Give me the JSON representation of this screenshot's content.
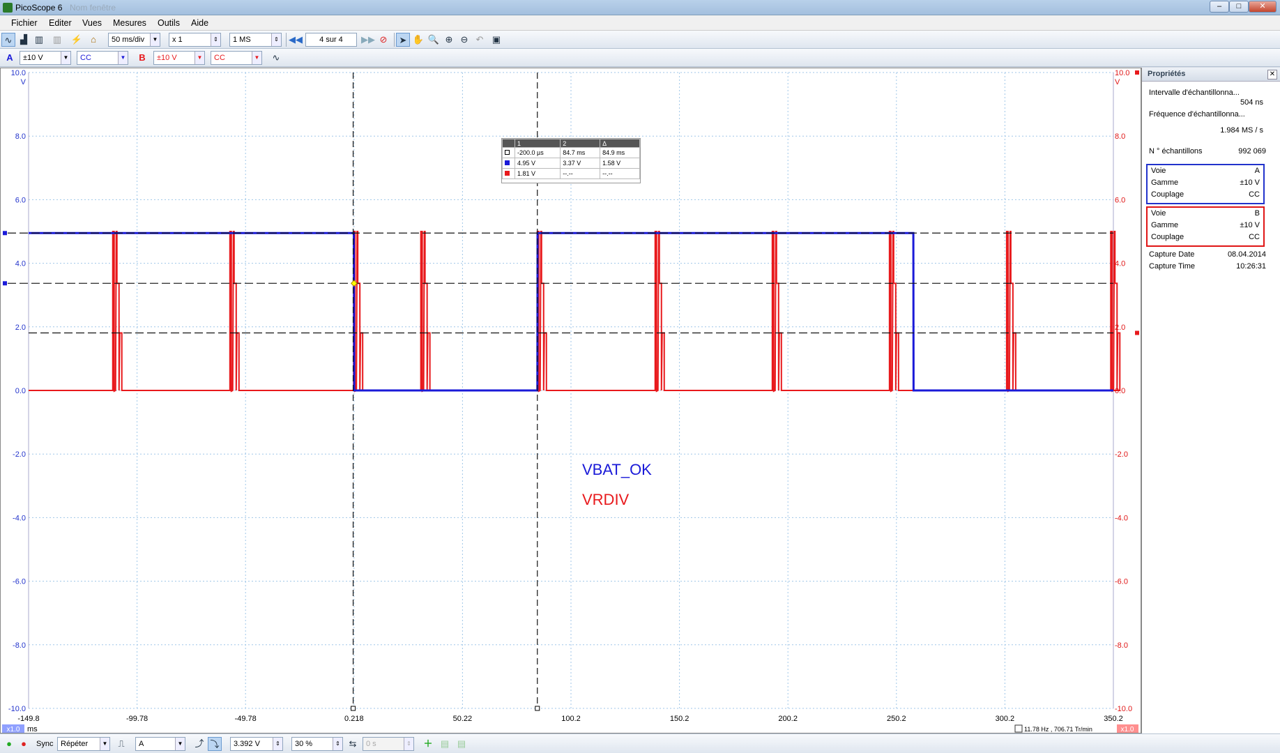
{
  "window": {
    "title": "PicoScope 6",
    "ghost_title": "Nom fenêtre",
    "btn_min": "–",
    "btn_max": "□",
    "btn_close": "✕"
  },
  "menu": [
    "Fichier",
    "Editer",
    "Vues",
    "Mesures",
    "Outils",
    "Aide"
  ],
  "toolbar1": {
    "timebase": "50 ms/div",
    "zoom": "x 1",
    "samples": "1 MS",
    "buffer": "4 sur 4"
  },
  "toolbar2": {
    "chA": {
      "label": "A",
      "range": "±10 V",
      "coupling": "CC"
    },
    "chB": {
      "label": "B",
      "range": "±10 V",
      "coupling": "CC"
    }
  },
  "scope": {
    "y_ticks_left": [
      "10.0",
      "8.0",
      "6.0",
      "4.0",
      "2.0",
      "0.0",
      "-2.0",
      "-4.0",
      "-6.0",
      "-8.0",
      "-10.0"
    ],
    "y_ticks_right": [
      "10.0",
      "8.0",
      "6.0",
      "4.0",
      "2.0",
      "0.0",
      "-2.0",
      "-4.0",
      "-6.0",
      "-8.0",
      "-10.0"
    ],
    "y_unit": "V",
    "x_ticks": [
      "-149.8",
      "-99.78",
      "-49.78",
      "0.218",
      "50.22",
      "100.2",
      "150.2",
      "200.2",
      "250.2",
      "300.2",
      "350.2"
    ],
    "x_unit": "ms",
    "x_zoom": "x1.0",
    "right_zoom": "x1.0",
    "annot_blue": "VBAT_OK",
    "annot_red": "VRDIV",
    "rate_readout": "11.78 Hz , 706.71 Tr/min",
    "colors": {
      "chA": "#1a1ad8",
      "chB": "#e8191c",
      "grid": "#9fc6e8",
      "axis_left": "#2233cc",
      "axis_right": "#e01515"
    }
  },
  "rulers": {
    "headers": [
      "1",
      "2",
      "Δ"
    ],
    "rows": [
      {
        "marker": "white",
        "v1": "-200.0 µs",
        "v2": "84.7 ms",
        "d": "84.9 ms"
      },
      {
        "marker": "blue",
        "v1": "4.95 V",
        "v2": "3.37 V",
        "d": "1.58 V"
      },
      {
        "marker": "red",
        "v1": "1.81 V",
        "v2": "--.--",
        "d": "--.--"
      }
    ]
  },
  "chart_data": {
    "type": "line",
    "title": "",
    "xlabel": "ms",
    "ylabel": "V",
    "xlim": [
      -149.8,
      350.2
    ],
    "ylim": [
      -10,
      10
    ],
    "grid": true,
    "series": [
      {
        "name": "VBAT_OK",
        "x": [
          -149.8,
          0.1,
          0.3,
          84.7,
          84.8,
          258,
          258.1,
          350.2
        ],
        "y": [
          4.95,
          4.95,
          0,
          0,
          4.95,
          4.95,
          0,
          0
        ]
      },
      {
        "name": "VRDIV",
        "pulses_ms": [
          -111,
          -57,
          0,
          31,
          84.7,
          139,
          193,
          247,
          301,
          349
        ],
        "high": 5.0,
        "low": 0.0
      }
    ],
    "cursors_x_ms": [
      -0.2,
      84.7
    ],
    "cursors_y_v": [
      4.95,
      3.37,
      1.81
    ]
  },
  "properties": {
    "title": "Propriétés",
    "interval_label": "Intervalle d'échantillonna...",
    "interval_value": "504 ns",
    "freq_label": "Fréquence d'échantillonna...",
    "freq_value": "1.984 MS / s",
    "nsamples_label": "N ° échantillons",
    "nsamples_value": "992 069",
    "chA": {
      "voie": "Voie",
      "voie_v": "A",
      "gamme": "Gamme",
      "gamme_v": "±10 V",
      "coup": "Couplage",
      "coup_v": "CC"
    },
    "chB": {
      "voie": "Voie",
      "voie_v": "B",
      "gamme": "Gamme",
      "gamme_v": "±10 V",
      "coup": "Couplage",
      "coup_v": "CC"
    },
    "capture_date_label": "Capture Date",
    "capture_date": "08.04.2014",
    "capture_time_label": "Capture Time",
    "capture_time": "10:26:31"
  },
  "status": {
    "sync_label": "Sync",
    "mode": "Répéter",
    "source": "A",
    "level": "3.392 V",
    "pretrig": "30 %",
    "delay": "0 s"
  }
}
